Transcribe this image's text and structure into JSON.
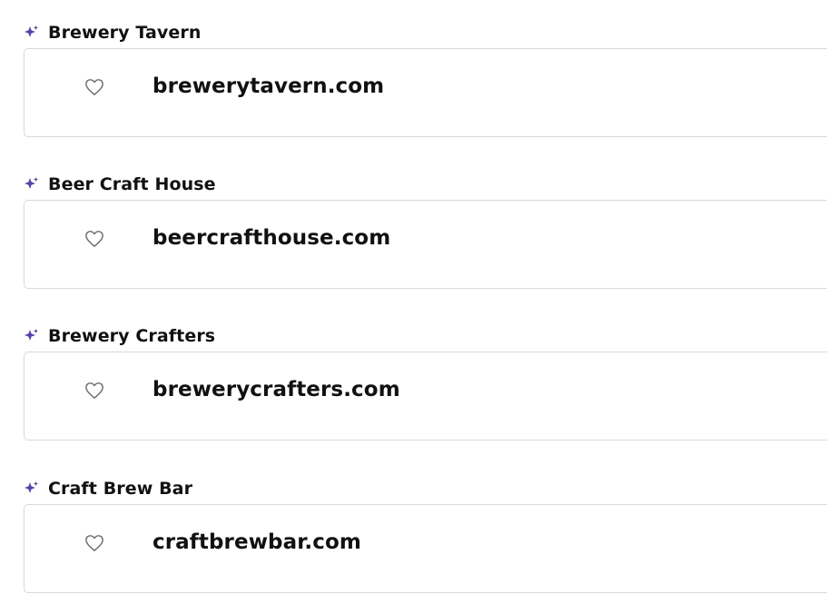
{
  "colors": {
    "accent": "#5b3fa8",
    "card_border": "#d9d9dd",
    "text": "#111111",
    "heart_stroke": "#6b6b6b"
  },
  "suggestions": [
    {
      "title": "Brewery Tavern",
      "domain": "brewerytavern.com",
      "icon": "sparkle-icon",
      "favorite_icon": "heart-icon"
    },
    {
      "title": "Beer Craft House",
      "domain": "beercrafthouse.com",
      "icon": "sparkle-icon",
      "favorite_icon": "heart-icon"
    },
    {
      "title": "Brewery Crafters",
      "domain": "brewerycrafters.com",
      "icon": "sparkle-icon",
      "favorite_icon": "heart-icon"
    },
    {
      "title": "Craft Brew Bar",
      "domain": "craftbrewbar.com",
      "icon": "sparkle-icon",
      "favorite_icon": "heart-icon"
    }
  ]
}
